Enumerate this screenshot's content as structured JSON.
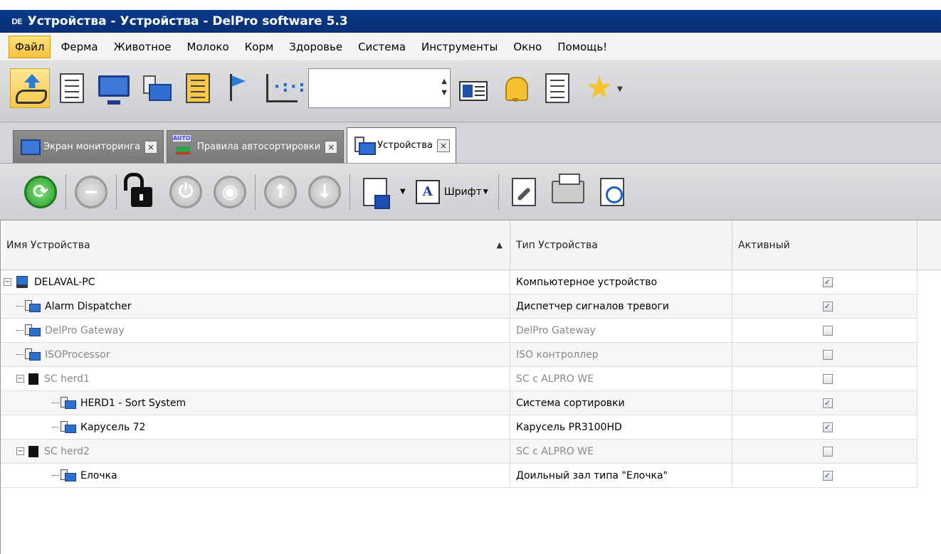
{
  "window": {
    "title": "Устройства - Устройства - DelPro software 5.3",
    "app_icon_text": "DE"
  },
  "menu": [
    "Файл",
    "Ферма",
    "Животное",
    "Молоко",
    "Корм",
    "Здоровье",
    "Система",
    "Инструменты",
    "Окно",
    "Помощь!"
  ],
  "toolbar": {
    "icons": [
      "hand-arrow-icon",
      "hand-doc-icon",
      "monitor-home-icon",
      "device-icon",
      "hand-doc-yellow-icon",
      "flag-chart-icon",
      "scatter-chart-icon",
      "card-icon",
      "hand-bell-icon",
      "bell-doc-icon",
      "star-icon"
    ],
    "search_value": ""
  },
  "tabs": [
    {
      "label": "Экран мониторинга",
      "state": "inactive"
    },
    {
      "label": "Правила автосортировки",
      "state": "inactive"
    },
    {
      "label": "Устройства",
      "state": "active"
    }
  ],
  "tab_close_glyph": "×",
  "secondary_toolbar": {
    "font_label": "Шрифт"
  },
  "grid": {
    "columns": [
      "Имя Устройства",
      "Тип Устройства",
      "Активный"
    ],
    "sort_glyph": "▲",
    "rows": [
      {
        "name": "DELAVAL-PC",
        "type": "Компьютерное устройство",
        "active": true,
        "dim": false,
        "level": 0,
        "kind": "pc"
      },
      {
        "name": "Alarm Dispatcher",
        "type": "Диспетчер сигналов тревоги",
        "active": true,
        "dim": false,
        "level": 1,
        "kind": "device"
      },
      {
        "name": "DelPro Gateway",
        "type": "DelPro Gateway",
        "active": false,
        "dim": true,
        "level": 1,
        "kind": "device"
      },
      {
        "name": "ISOProcessor",
        "type": "ISO контроллер",
        "active": false,
        "dim": true,
        "level": 1,
        "kind": "device"
      },
      {
        "name": "SC herd1",
        "type": "SC с ALPRO WE",
        "active": false,
        "dim": true,
        "level": 1,
        "kind": "sc"
      },
      {
        "name": "HERD1 - Sort System",
        "type": "Система сортировки",
        "active": true,
        "dim": false,
        "level": 2,
        "kind": "device"
      },
      {
        "name": "Карусель 72",
        "type": "Карусель PR3100HD",
        "active": true,
        "dim": false,
        "level": 2,
        "kind": "device"
      },
      {
        "name": "SC herd2",
        "type": "SC с ALPRO WE",
        "active": false,
        "dim": true,
        "level": 1,
        "kind": "sc"
      },
      {
        "name": "Елочка",
        "type": "Доильный зал типа \"Елочка\"",
        "active": true,
        "dim": false,
        "level": 2,
        "kind": "device"
      }
    ]
  }
}
